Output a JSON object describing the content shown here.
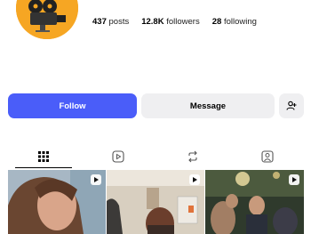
{
  "profile": {
    "avatar_icon": "film-camera-avatar",
    "avatar_color": "#f6a623",
    "stats": [
      {
        "value": "437",
        "label": "posts"
      },
      {
        "value": "12.8K",
        "label": "followers"
      },
      {
        "value": "28",
        "label": "following"
      }
    ]
  },
  "actions": {
    "follow_label": "Follow",
    "message_label": "Message",
    "add_user_icon": "add-person-icon",
    "accent": "#4a5df9"
  },
  "tabs": [
    {
      "icon": "grid-icon",
      "active": true
    },
    {
      "icon": "reels-icon",
      "active": false
    },
    {
      "icon": "reposts-icon",
      "active": false
    },
    {
      "icon": "tagged-icon",
      "active": false
    }
  ],
  "posts": [
    {
      "type": "reel",
      "icon": "reel-icon"
    },
    {
      "type": "reel",
      "icon": "reel-icon"
    },
    {
      "type": "reel",
      "icon": "reel-icon"
    }
  ]
}
